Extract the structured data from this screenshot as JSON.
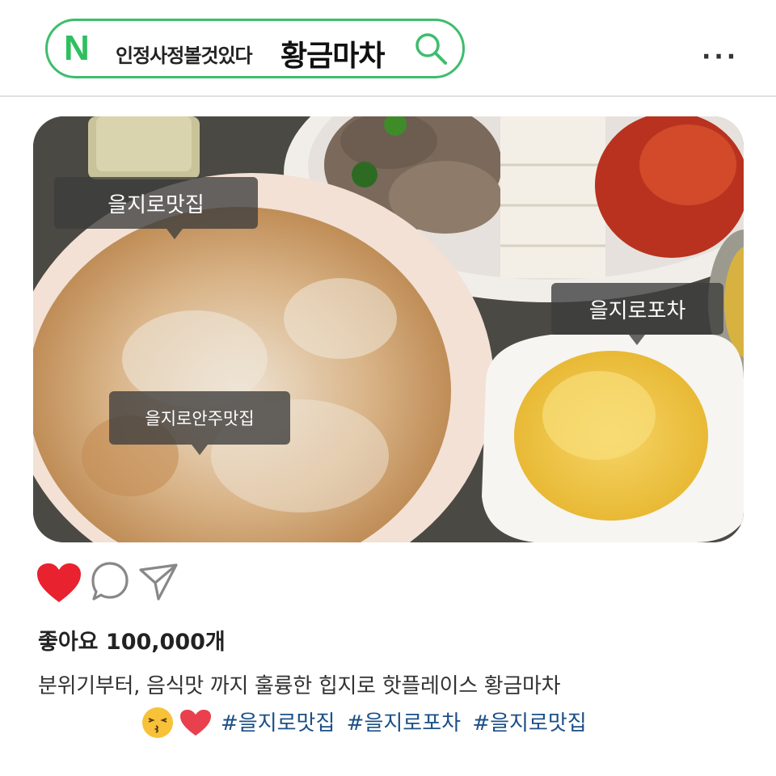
{
  "search": {
    "logo": "N",
    "prefix": "인정사정볼것있다",
    "keyword": "황금마차",
    "icon": "search-icon"
  },
  "header": {
    "more_label": "···",
    "more_icon": "more-dots-icon"
  },
  "photo": {
    "tags": [
      "을지로맛집",
      "을지로포차",
      "을지로안주맛집"
    ]
  },
  "actions": {
    "like_icon": "heart-icon",
    "comment_icon": "comment-icon",
    "share_icon": "send-icon"
  },
  "post": {
    "likes": "좋아요 100,000개",
    "caption": "분위기부터, 음식맛 까지 훌륭한 힙지로 핫플레이스 황금마차",
    "emojis": [
      "kissing-face-emoji",
      "heart-emoji"
    ],
    "hashtags": [
      "#을지로맛집",
      "#을지로포차",
      "#을지로맛집"
    ]
  },
  "colors": {
    "search_border": "#3dbd6c",
    "logo_green": "#2fbf5f",
    "heart_red": "#e8222e",
    "hashtag_blue": "#1b4f86"
  }
}
